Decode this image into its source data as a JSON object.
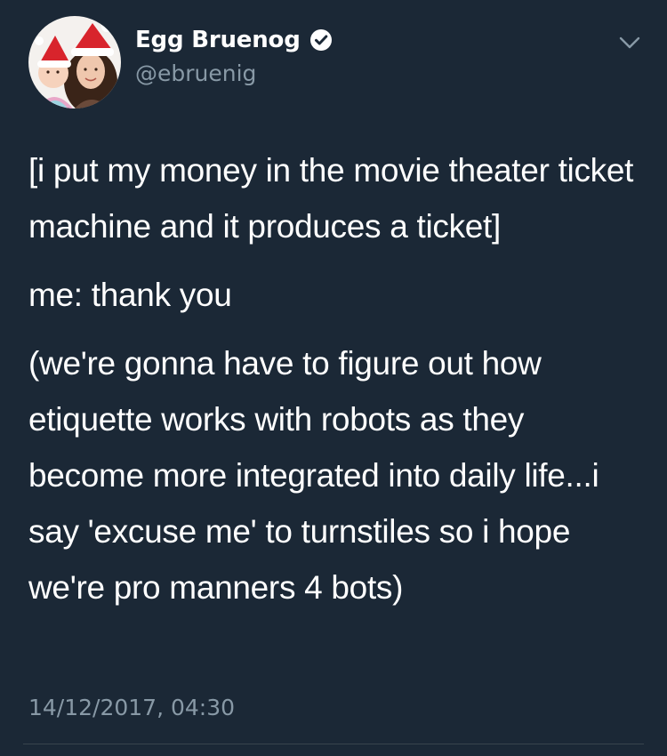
{
  "user": {
    "display_name": "Egg Bruenog",
    "handle": "@ebruenig",
    "verified": true
  },
  "tweet": {
    "paragraphs": [
      "[i put my money in the movie theater ticket machine and it produces a ticket]",
      "me: thank you",
      "(we're gonna have to figure out how etiquette works with robots as they become more integrated into daily life...i say 'excuse me' to turnstiles so i hope we're pro manners 4 bots)"
    ],
    "timestamp": "14/12/2017, 04:30"
  },
  "icons": {
    "verified": "verified-badge-icon",
    "menu": "chevron-down-icon"
  },
  "colors": {
    "background": "#1b2836",
    "primary_text": "#ffffff",
    "secondary_text": "#8899a6",
    "divider": "#38444d"
  }
}
